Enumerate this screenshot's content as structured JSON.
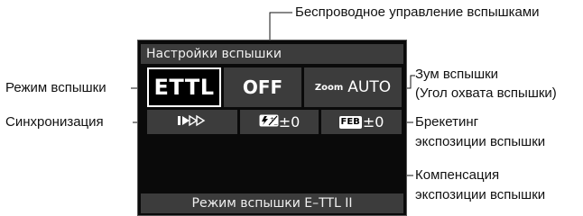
{
  "callouts": {
    "wireless": "Беспроводное управление вспышками",
    "flash_mode": "Режим вспышки",
    "sync": "Синхронизация",
    "zoom_line1": "Зум вспышки",
    "zoom_line2": "(Угол охвата вспышки)",
    "feb_line1": "Брекетинг",
    "feb_line2": "экспозиции вспышки",
    "comp_line1": "Компенсация",
    "comp_line2": "экспозиции вспышки"
  },
  "screen": {
    "title": "Настройки вспышки",
    "flash_mode_value": "ETTL",
    "wireless_value": "OFF",
    "zoom_word": "Zoom",
    "zoom_value": "AUTO",
    "sync_icon": "high-speed-sync-icon",
    "comp_value": "±0",
    "comp_icon": "flash-exposure-comp-icon",
    "feb_badge": "FEB",
    "feb_value": "±0",
    "status_text": "Режим вспышки E–TTL II"
  }
}
